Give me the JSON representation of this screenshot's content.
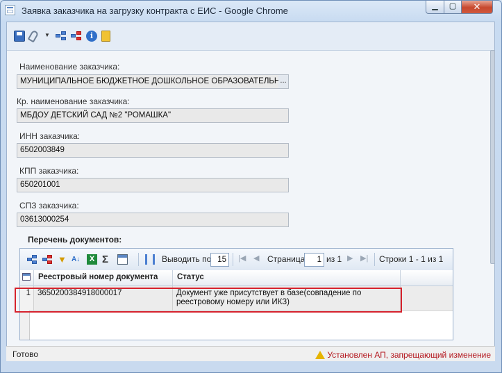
{
  "window": {
    "title": "Заявка заказчика на загрузку контракта с ЕИС - Google Chrome",
    "close_label": "✕"
  },
  "form": {
    "customer_name_label": "Наименование заказчика:",
    "customer_name_value": "МУНИЦИПАЛЬНОЕ БЮДЖЕТНОЕ ДОШКОЛЬНОЕ ОБРАЗОВАТЕЛЬНС",
    "lookup_button_label": "...",
    "short_name_label": "Кр. наименование заказчика:",
    "short_name_value": "МБДОУ ДЕТСКИЙ САД №2 \"РОМАШКА\"",
    "inn_label": "ИНН заказчика:",
    "inn_value": "6502003849",
    "kpp_label": "КПП заказчика:",
    "kpp_value": "650201001",
    "spz_label": "СПЗ заказчика:",
    "spz_value": "03613000254"
  },
  "documents": {
    "group_title": "Перечень документов:",
    "pager": {
      "show_label": "Выводить по",
      "per_page": "15",
      "page_label": "Страница",
      "page": "1",
      "of_label": "из 1",
      "rows_label": "Строки 1 - 1 из 1"
    },
    "columns": [
      "Реестровый номер документа",
      "Статус"
    ],
    "rows": [
      {
        "num": "1",
        "reg_number": "3650200384918000017",
        "status": "Документ уже присутствует в базе(совпадение по реестровому номеру или ИКЗ)"
      }
    ]
  },
  "status_bar": {
    "left": "Готово",
    "right": "Установлен АП, запрещающий изменение"
  },
  "icons": [
    "save-icon",
    "attach-icon",
    "add-structure-icon",
    "remove-structure-icon",
    "info-icon",
    "exit-icon",
    "filter-icon",
    "sort-icon",
    "excel-icon",
    "sum-icon",
    "table-settings-icon",
    "column-icon"
  ]
}
